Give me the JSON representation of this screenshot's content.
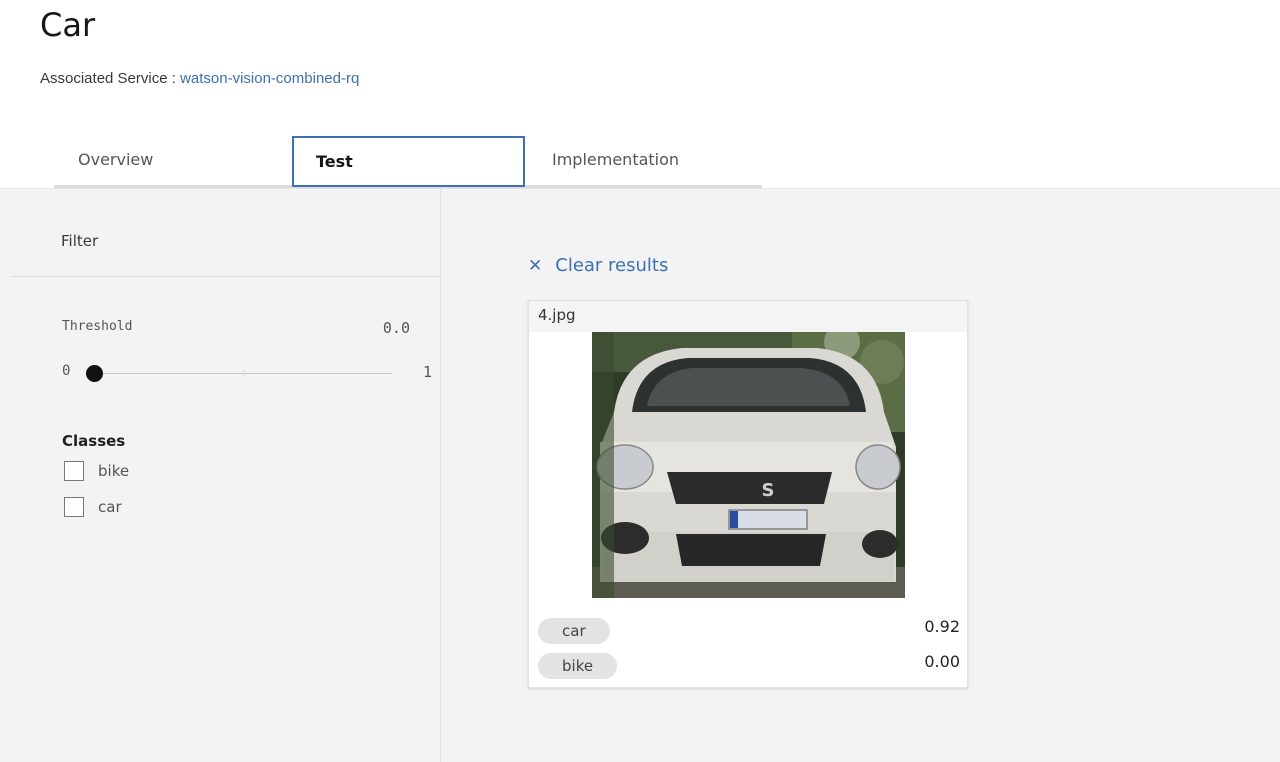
{
  "header": {
    "title": "Car",
    "service_label": "Associated Service : ",
    "service_name": "watson-vision-combined-rq"
  },
  "tabs": [
    {
      "label": "Overview",
      "active": false
    },
    {
      "label": "Test",
      "active": true
    },
    {
      "label": "Implementation",
      "active": false
    }
  ],
  "sidebar": {
    "filter_label": "Filter",
    "threshold": {
      "label": "Threshold",
      "value": "0.0",
      "min": "0",
      "max": "1",
      "level": 0.0
    },
    "classes_title": "Classes",
    "classes": [
      {
        "label": "bike",
        "checked": false
      },
      {
        "label": "car",
        "checked": false
      }
    ]
  },
  "results": {
    "clear_icon": "close-icon",
    "clear_label": "Clear results",
    "card": {
      "filename": "4.jpg",
      "image": "photo of white car front",
      "scores": [
        {
          "class": "car",
          "score": "0.92"
        },
        {
          "class": "bike",
          "score": "0.00"
        }
      ]
    }
  },
  "colors": {
    "accent": "#3d70b2",
    "workspace_bg": "#f3f3f3",
    "tag_bg": "#e3e3e3"
  }
}
